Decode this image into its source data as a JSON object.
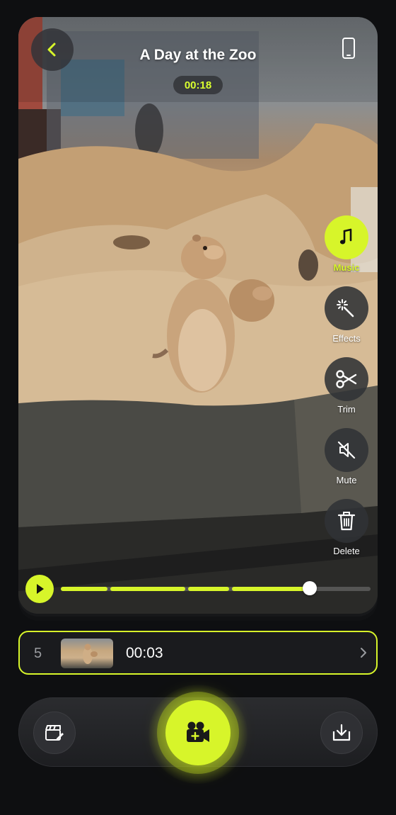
{
  "header": {
    "title": "A Day at the Zoo",
    "elapsed": "00:18"
  },
  "tools": [
    {
      "label": "Music",
      "icon": "music-note-icon",
      "active": true
    },
    {
      "label": "Effects",
      "icon": "sparkle-wand-icon",
      "active": false
    },
    {
      "label": "Trim",
      "icon": "scissors-icon",
      "active": false
    },
    {
      "label": "Mute",
      "icon": "speaker-muted-icon",
      "active": false
    },
    {
      "label": "Delete",
      "icon": "trash-icon",
      "active": false
    }
  ],
  "playback": {
    "progress": 0.8
  },
  "clip": {
    "index": "5",
    "duration": "00:03"
  },
  "colors": {
    "accent": "#d7f52a",
    "background": "#0e0f11",
    "surface": "#1a1b1e"
  }
}
